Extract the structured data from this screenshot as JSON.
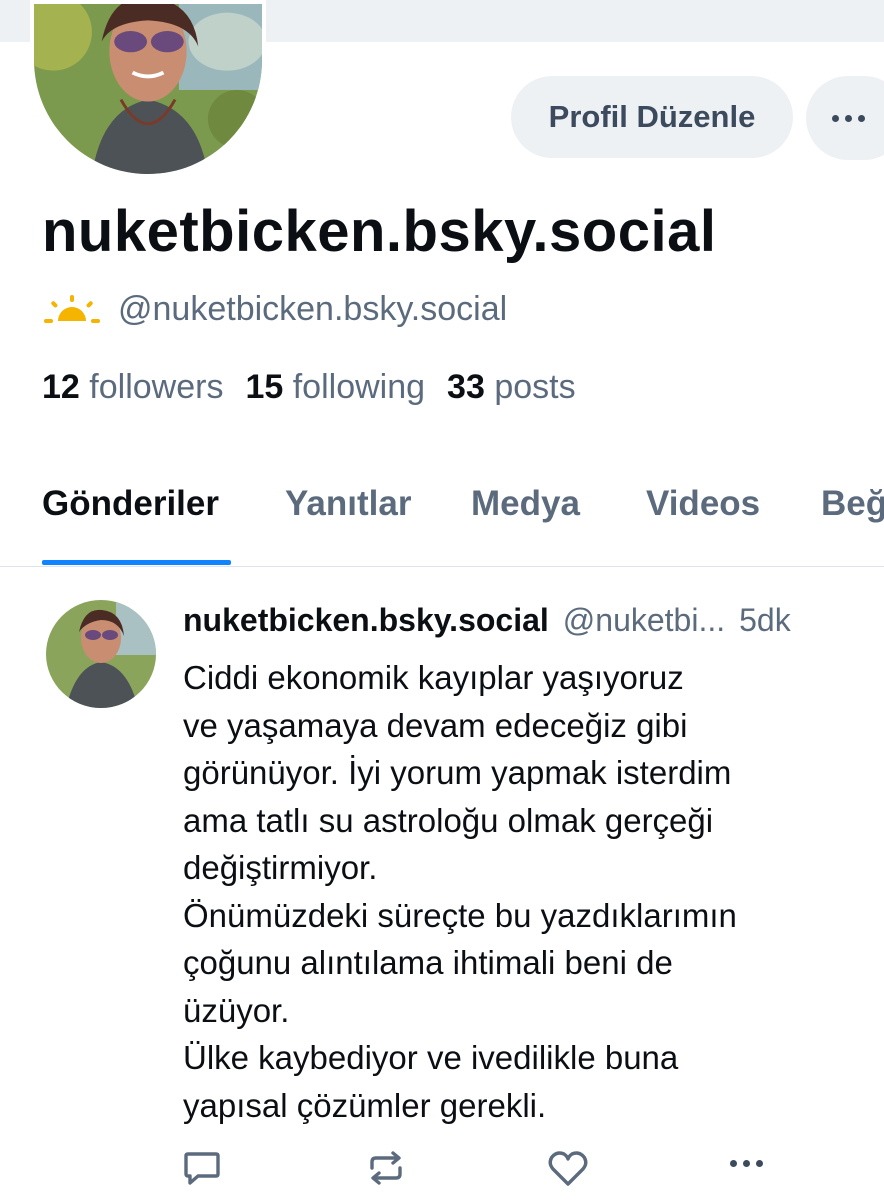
{
  "profile": {
    "display_name": "nuketbicken.bsky.social",
    "handle": "@nuketbicken.bsky.social",
    "handle_emoji": "sunrise-icon",
    "edit_button": "Profil Düzenle",
    "stats": {
      "followers_count": "12",
      "followers_label": "followers",
      "following_count": "15",
      "following_label": "following",
      "posts_count": "33",
      "posts_label": "posts"
    }
  },
  "tabs": [
    {
      "label": "Gönderiler",
      "active": true
    },
    {
      "label": "Yanıtlar",
      "active": false
    },
    {
      "label": "Medya",
      "active": false
    },
    {
      "label": "Videos",
      "active": false
    },
    {
      "label": "Beğ",
      "active": false
    }
  ],
  "post": {
    "author": "nuketbicken.bsky.social",
    "handle": "@nuketbi...",
    "time": "5dk",
    "lines": [
      "Ciddi ekonomik kayıplar yaşıyoruz",
      "ve yaşamaya devam edeceğiz gibi",
      "görünüyor. İyi yorum yapmak isterdim",
      "ama tatlı su astroloğu olmak gerçeği",
      "değiştirmiyor.",
      "Önümüzdeki süreçte bu yazdıklarımın",
      "çoğunu alıntılama ihtimali beni de",
      "üzüyor.",
      "Ülke kaybediyor ve ivedilikle buna",
      "yapısal çözümler gerekli."
    ]
  },
  "colors": {
    "accent": "#1083fe",
    "text_primary": "#0b0f14",
    "text_secondary": "#5b6b7d",
    "button_bg": "#eef1f4",
    "sun_icon": "#f5b400"
  },
  "icons": [
    "reply-icon",
    "repost-icon",
    "like-icon",
    "more-icon"
  ]
}
